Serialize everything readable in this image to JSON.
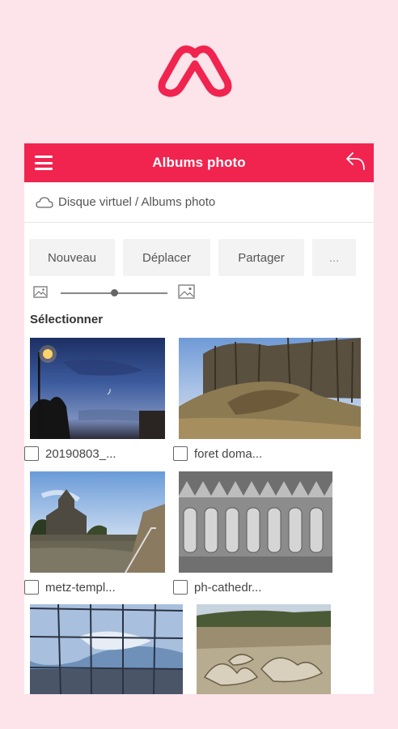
{
  "header": {
    "title": "Albums photo"
  },
  "breadcrumb": {
    "text": "Disque virtuel / Albums photo"
  },
  "toolbar": {
    "new_label": "Nouveau",
    "move_label": "Déplacer",
    "share_label": "Partager",
    "more_label": "..."
  },
  "zoom": {
    "level": 0.5
  },
  "select_label": "Sélectionner",
  "photos": [
    {
      "name": "20190803_..."
    },
    {
      "name": "foret doma..."
    },
    {
      "name": "metz-templ..."
    },
    {
      "name": "ph-cathedr..."
    },
    {
      "name": ""
    },
    {
      "name": ""
    }
  ],
  "colors": {
    "accent": "#f0244f",
    "background": "#fde3ea"
  }
}
